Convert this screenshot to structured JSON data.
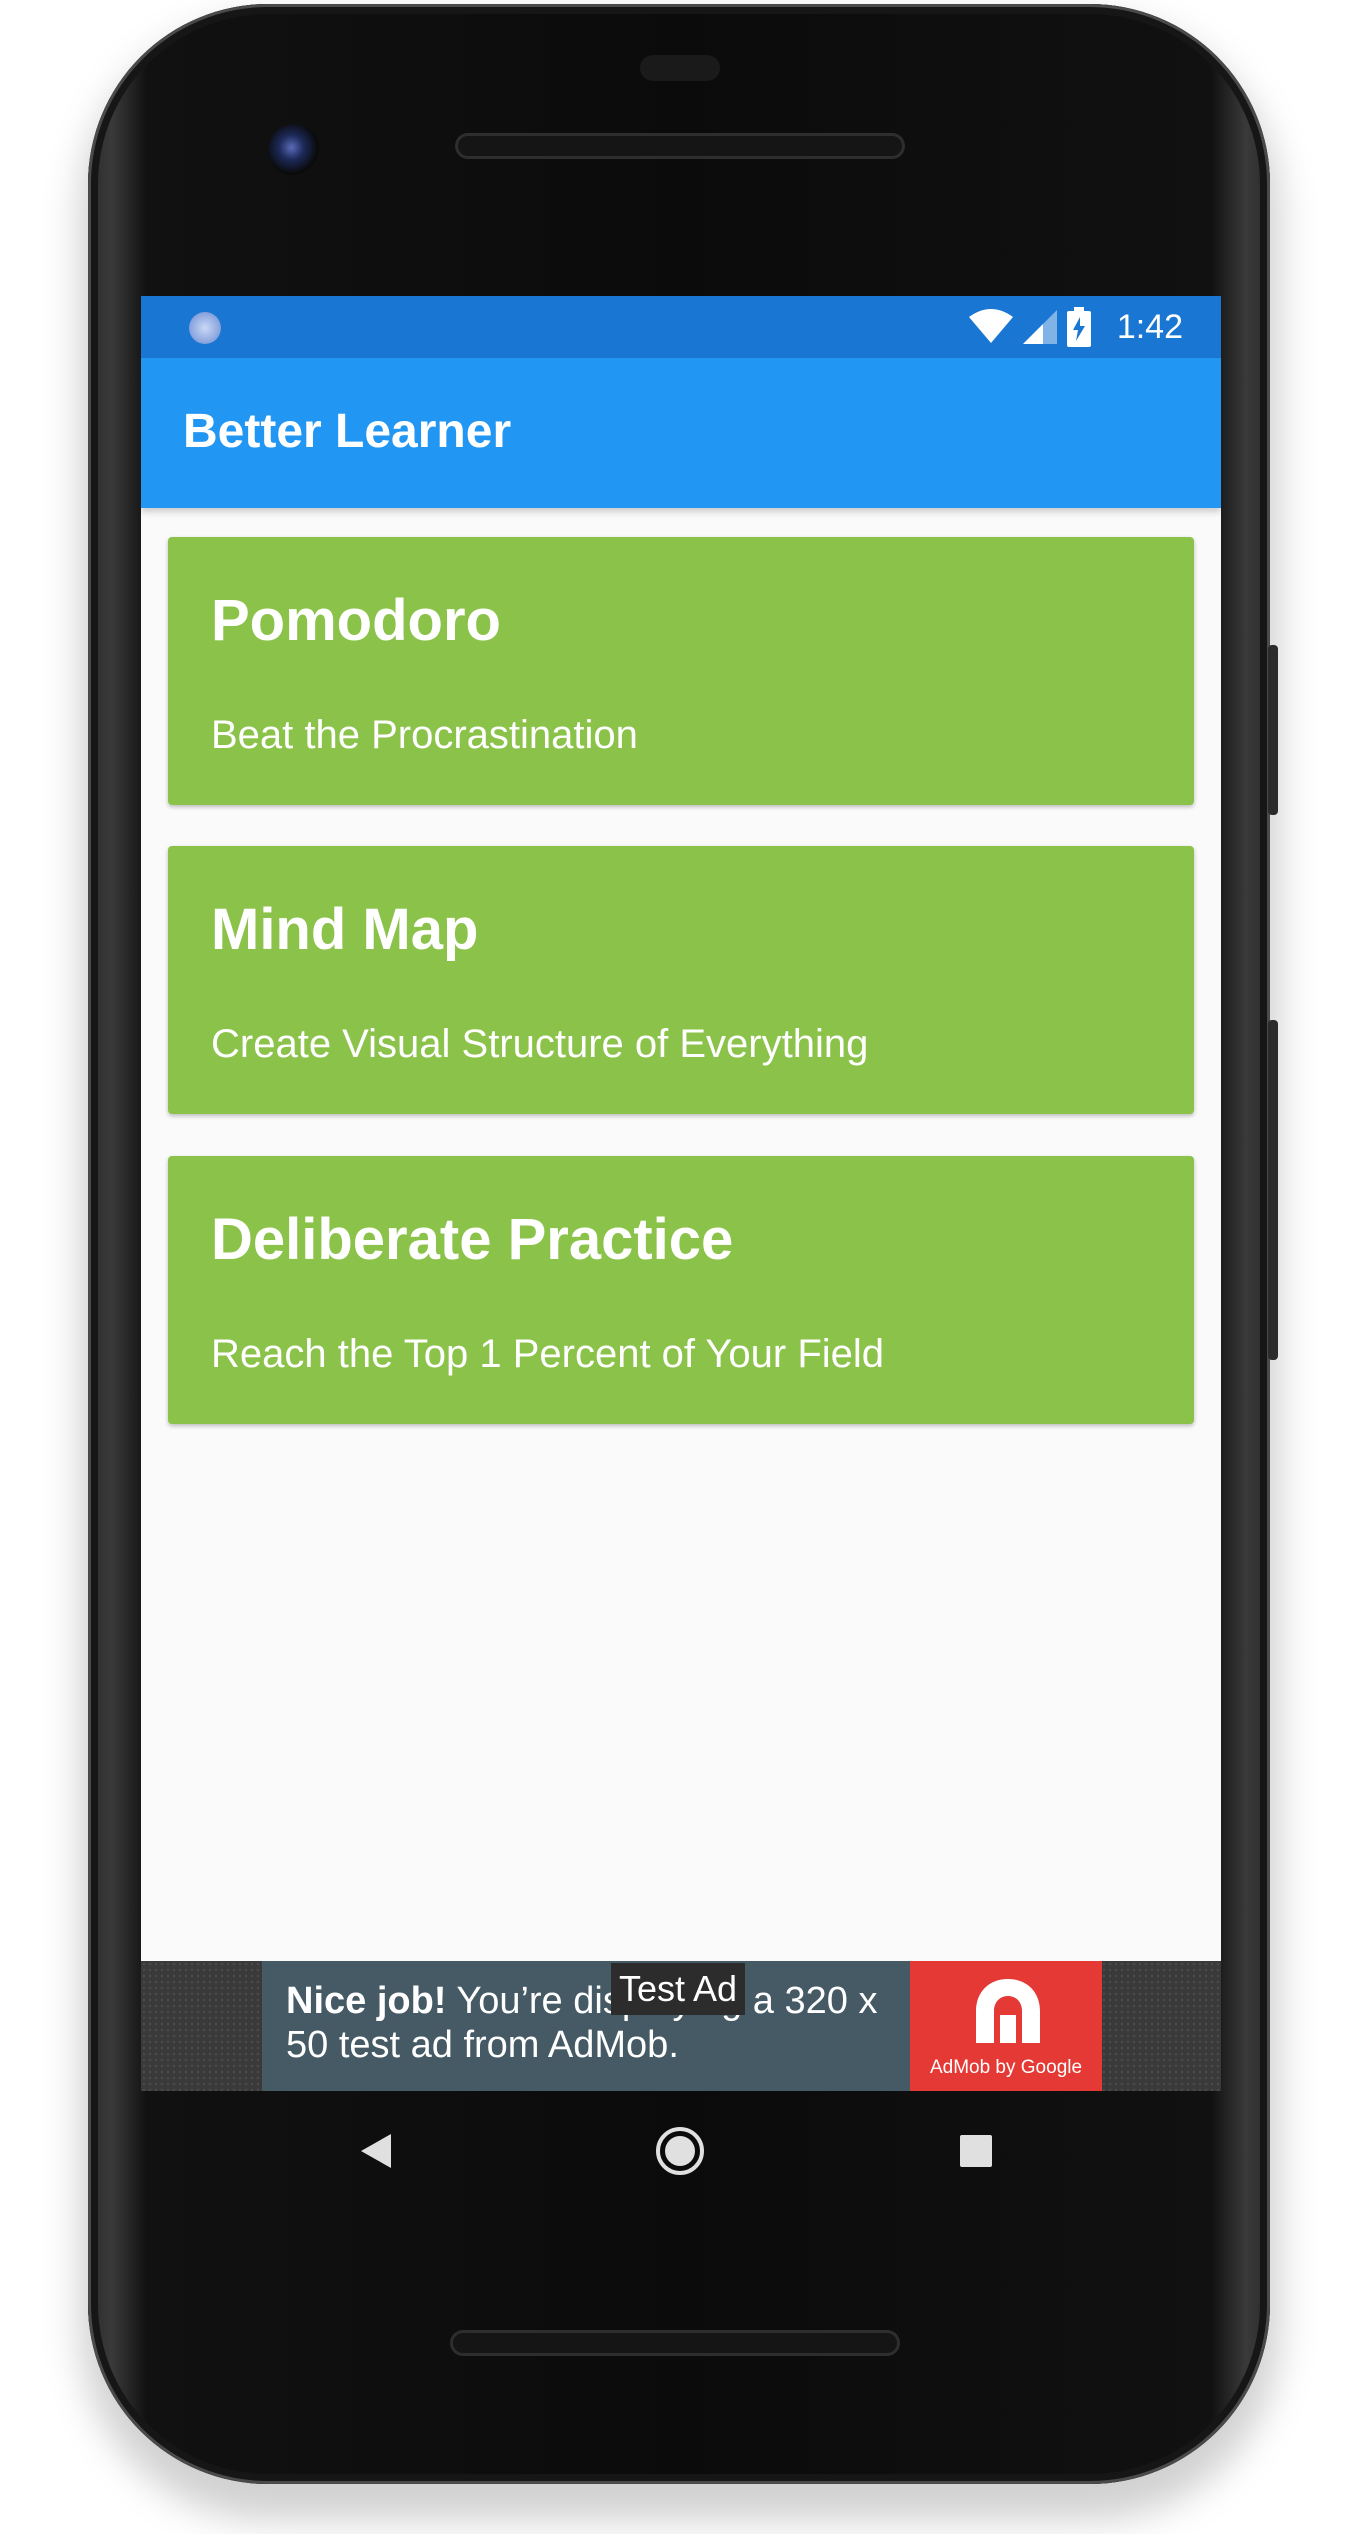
{
  "status_bar": {
    "time": "1:42",
    "icons": [
      "notification-dot-icon",
      "wifi-icon",
      "signal-icon",
      "battery-charging-icon"
    ]
  },
  "app_bar": {
    "title": "Better Learner"
  },
  "cards": [
    {
      "title": "Pomodoro",
      "subtitle": "Beat the Procrastination"
    },
    {
      "title": "Mind Map",
      "subtitle": "Create Visual Structure of Everything"
    },
    {
      "title": "Deliberate Practice",
      "subtitle": "Reach the Top 1 Percent of Your Field"
    }
  ],
  "ad": {
    "label": "Test Ad",
    "headline_bold": "Nice job!",
    "headline_rest": " You’re displaying a 320 x 50 test ad from AdMob.",
    "logo_text": "AdMob by Google"
  },
  "nav_bar": {
    "icons": [
      "back-icon",
      "home-icon",
      "recents-icon"
    ]
  },
  "colors": {
    "status_bar": "#1976d2",
    "app_bar": "#2196f3",
    "card": "#8bc34a",
    "background": "#fafafa",
    "ad_banner": "#455a64",
    "ad_logo": "#e53935"
  }
}
